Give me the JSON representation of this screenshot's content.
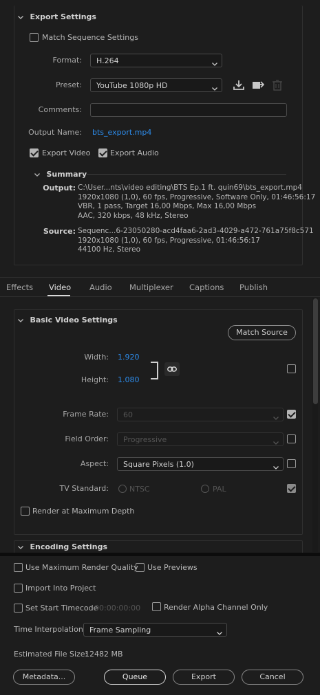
{
  "export_settings": {
    "title": "Export Settings",
    "match_sequence": "Match Sequence Settings",
    "format_label": "Format:",
    "format_value": "H.264",
    "preset_label": "Preset:",
    "preset_value": "YouTube 1080p HD",
    "comments_label": "Comments:",
    "output_name_label": "Output Name:",
    "output_name_value": "bts_export.mp4",
    "export_video": "Export Video",
    "export_audio": "Export Audio",
    "summary_title": "Summary",
    "output_key": "Output:",
    "output_lines": [
      "C:\\User...nts\\video editing\\BTS Ep.1 ft. quin69\\bts_export.mp4",
      "1920x1080 (1,0), 60 fps, Progressive, Software Only, 01:46:56:17",
      "VBR, 1 pass, Target 16,00 Mbps, Max 16,00 Mbps",
      "AAC, 320 kbps, 48 kHz, Stereo"
    ],
    "source_key": "Source:",
    "source_lines": [
      "Sequenc...6-23050280-acd4faa6-2ad3-4029-a472-761a75f8c571",
      "1920x1080 (1,0), 60 fps, Progressive, 01:46:56:17",
      "44100 Hz, Stereo"
    ]
  },
  "tabs": [
    "Effects",
    "Video",
    "Audio",
    "Multiplexer",
    "Captions",
    "Publish"
  ],
  "active_tab": "Video",
  "basic_video": {
    "title": "Basic Video Settings",
    "match_source": "Match Source",
    "width_label": "Width:",
    "width_value": "1.920",
    "height_label": "Height:",
    "height_value": "1.080",
    "frame_rate_label": "Frame Rate:",
    "frame_rate_value": "60",
    "field_order_label": "Field Order:",
    "field_order_value": "Progressive",
    "aspect_label": "Aspect:",
    "aspect_value": "Square Pixels (1.0)",
    "tv_standard_label": "TV Standard:",
    "ntsc": "NTSC",
    "pal": "PAL",
    "render_max_depth": "Render at Maximum Depth"
  },
  "encoding": {
    "title": "Encoding Settings"
  },
  "bottom": {
    "max_render_quality": "Use Maximum Render Quality",
    "use_previews": "Use Previews",
    "import_into_project": "Import Into Project",
    "set_start_timecode": "Set Start Timecode",
    "timecode_value": "00:00:00:00",
    "render_alpha": "Render Alpha Channel Only",
    "time_interp_label": "Time Interpolation:",
    "time_interp_value": "Frame Sampling",
    "est_size_label": "Estimated File Size:",
    "est_size_value": "12482 MB",
    "metadata": "Metadata...",
    "queue": "Queue",
    "export": "Export",
    "cancel": "Cancel"
  },
  "colors": {
    "background": "#1d1d1d",
    "accent_blue": "#2d8ceb",
    "text": "#b8b8b8"
  }
}
